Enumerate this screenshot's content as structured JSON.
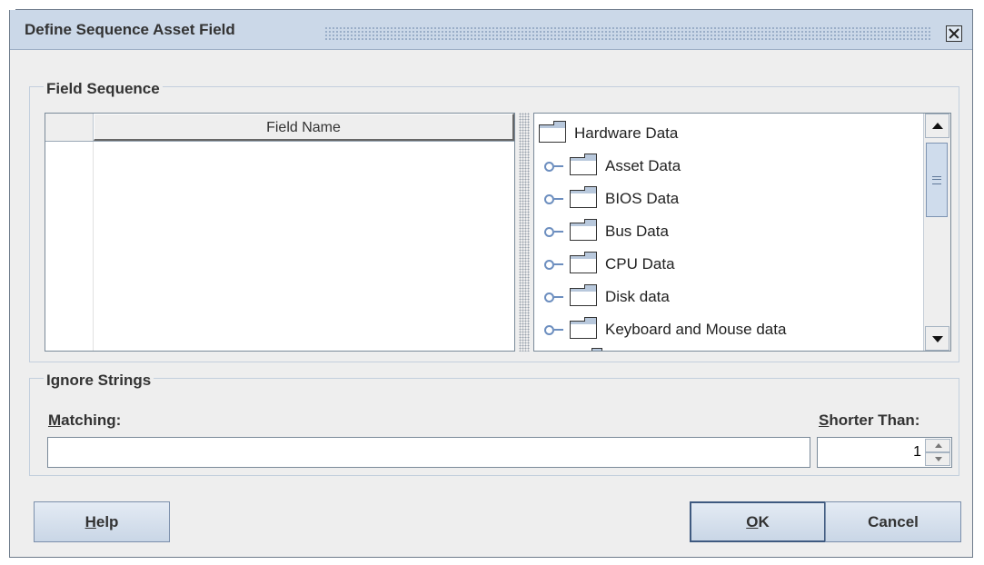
{
  "dialog": {
    "title": "Define Sequence Asset Field"
  },
  "field_sequence": {
    "group_title": "Field Sequence",
    "table": {
      "columns": [
        "Field Name"
      ],
      "rows": []
    },
    "tree": {
      "root": "Hardware Data",
      "children": [
        "Asset Data",
        "BIOS Data",
        "Bus Data",
        "CPU Data",
        "Disk data",
        "Keyboard and Mouse data"
      ]
    }
  },
  "ignore_strings": {
    "group_title": "Ignore Strings",
    "matching_label_mnemonic": "M",
    "matching_label_rest": "atching:",
    "matching_value": "",
    "shorter_than_label_mnemonic": "S",
    "shorter_than_label_rest": "horter Than:",
    "shorter_than_value": "1"
  },
  "buttons": {
    "help_mnemonic": "H",
    "help_rest": "elp",
    "ok_mnemonic": "O",
    "ok_rest": "K",
    "cancel": "Cancel"
  },
  "icons": {
    "close": "close-icon",
    "folder": "folder-icon",
    "expander": "tree-expander-icon",
    "scroll_up": "arrow-up-icon",
    "scroll_down": "arrow-down-icon"
  }
}
